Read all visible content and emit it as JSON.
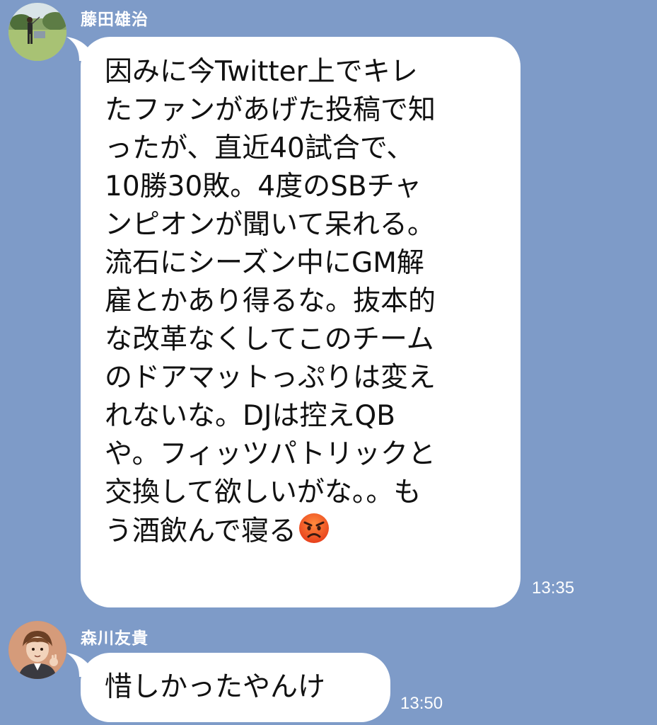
{
  "messages": [
    {
      "sender": "藤田雄治",
      "lines": [
        "因みに今Twitter上でキレ",
        "たファンがあげた投稿で知",
        "ったが、直近40試合で、",
        "10勝30敗。4度のSBチャ",
        "ンピオンが聞いて呆れる。",
        "流石にシーズン中にGM解",
        "雇とかあり得るな。抜本的",
        "な改革なくしてこのチーム",
        "のドアマットっぷりは変え",
        "れないな。DJは控えQB",
        "や。フィッツパトリックと",
        "交換して欲しいがな。。も",
        "う酒飲んで寝る"
      ],
      "emoji": "angry-face-icon",
      "time": "13:35"
    },
    {
      "sender": "森川友貴",
      "text": "惜しかったやんけ",
      "time": "13:50"
    }
  ],
  "colors": {
    "background": "#7e9bc8",
    "bubble": "#ffffff",
    "sender_text": "#ffffff",
    "time_text": "#ffffff",
    "message_text": "#111111"
  }
}
